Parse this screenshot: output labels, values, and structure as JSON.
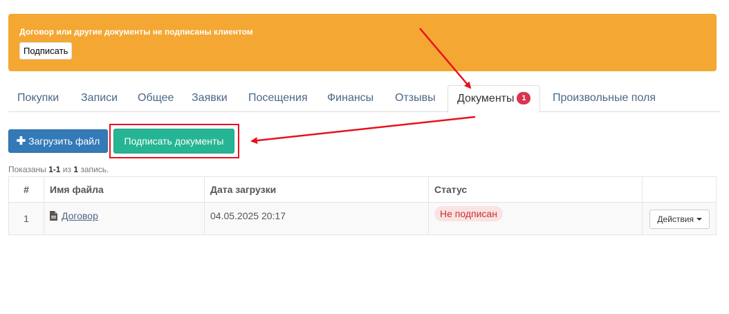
{
  "alert": {
    "message": "Договор или другие документы не подписаны клиентом",
    "sign_button": "Подписать",
    "color": "#f4a732"
  },
  "tabs": [
    {
      "label": "Покупки"
    },
    {
      "label": "Записи"
    },
    {
      "label": "Общее"
    },
    {
      "label": "Заявки"
    },
    {
      "label": "Посещения"
    },
    {
      "label": "Финансы"
    },
    {
      "label": "Отзывы"
    },
    {
      "label": "Документы",
      "badge": "1",
      "active": true
    },
    {
      "label": "Произвольные поля"
    }
  ],
  "toolbar": {
    "upload_label": "Загрузить файл",
    "upload_icon": "plus-icon",
    "sign_docs_label": "Подписать документы"
  },
  "summary": {
    "prefix": "Показаны ",
    "range": "1-1",
    "middle": " из ",
    "total": "1",
    "suffix": " запись."
  },
  "table": {
    "headers": [
      "#",
      "Имя файла",
      "Дата загрузки",
      "Статус",
      ""
    ],
    "rows": [
      {
        "num": "1",
        "file_icon": "file-icon",
        "file_name": "Договор",
        "date": "04.05.2025 20:17",
        "status": "Не подписан",
        "actions_label": "Действия"
      }
    ]
  },
  "colors": {
    "primary": "#337ab7",
    "success": "#26b594",
    "danger": "#d9334f",
    "annotation": "#e8101d"
  }
}
